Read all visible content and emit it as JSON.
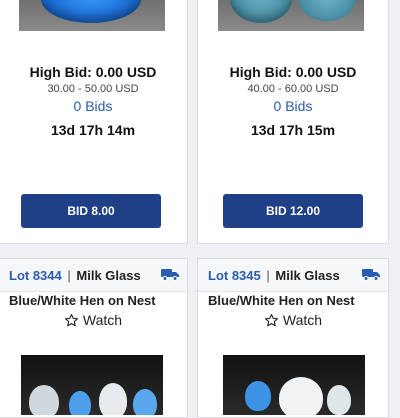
{
  "cards_top": [
    {
      "high_bid": "High Bid: 0.00 USD",
      "range": "30.00 - 50.00 USD",
      "bids": "0 Bids",
      "time_left": "13d 17h 14m",
      "bid_button": "BID 8.00"
    },
    {
      "high_bid": "High Bid: 0.00 USD",
      "range": "40.00 - 60.00 USD",
      "bids": "0 Bids",
      "time_left": "13d 17h 15m",
      "bid_button": "BID 12.00"
    }
  ],
  "cards_bottom": [
    {
      "lot_number": "Lot 8344",
      "separator": "|",
      "category": "Milk Glass",
      "title": "Blue/White Hen on Nest",
      "watch_label": "Watch",
      "icons": [
        "truck-icon",
        "star-icon"
      ]
    },
    {
      "lot_number": "Lot 8345",
      "separator": "|",
      "category": "Milk Glass",
      "title": "Blue/White Hen on Nest",
      "watch_label": "Watch",
      "icons": [
        "truck-icon",
        "star-icon"
      ]
    }
  ],
  "colors": {
    "accent_blue": "#2a5db0",
    "button_navy": "#1f3f86"
  }
}
